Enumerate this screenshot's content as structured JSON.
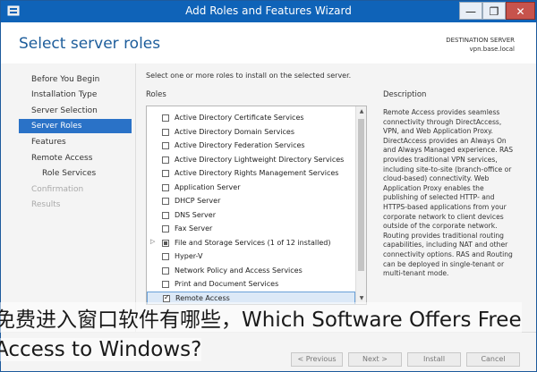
{
  "window": {
    "title": "Add Roles and Features Wizard",
    "controls": {
      "minimize": "—",
      "maximize": "❐",
      "close": "✕"
    }
  },
  "header": {
    "page_title": "Select server roles",
    "destination_label": "DESTINATION SERVER",
    "destination_value": "vpn.base.local"
  },
  "sidebar": {
    "items": [
      {
        "label": "Before You Begin",
        "state": "normal"
      },
      {
        "label": "Installation Type",
        "state": "normal"
      },
      {
        "label": "Server Selection",
        "state": "normal"
      },
      {
        "label": "Server Roles",
        "state": "active"
      },
      {
        "label": "Features",
        "state": "normal"
      },
      {
        "label": "Remote Access",
        "state": "normal"
      },
      {
        "label": "Role Services",
        "state": "sub"
      },
      {
        "label": "Confirmation",
        "state": "disabled"
      },
      {
        "label": "Results",
        "state": "disabled"
      }
    ]
  },
  "main": {
    "instruction": "Select one or more roles to install on the selected server.",
    "roles_heading": "Roles",
    "description_heading": "Description",
    "roles": [
      {
        "label": "Active Directory Certificate Services",
        "state": "unchecked"
      },
      {
        "label": "Active Directory Domain Services",
        "state": "unchecked"
      },
      {
        "label": "Active Directory Federation Services",
        "state": "unchecked"
      },
      {
        "label": "Active Directory Lightweight Directory Services",
        "state": "unchecked"
      },
      {
        "label": "Active Directory Rights Management Services",
        "state": "unchecked"
      },
      {
        "label": "Application Server",
        "state": "unchecked"
      },
      {
        "label": "DHCP Server",
        "state": "unchecked"
      },
      {
        "label": "DNS Server",
        "state": "unchecked"
      },
      {
        "label": "Fax Server",
        "state": "unchecked"
      },
      {
        "label": "File and Storage Services (1 of 12 installed)",
        "state": "partial",
        "expandable": true
      },
      {
        "label": "Hyper-V",
        "state": "unchecked"
      },
      {
        "label": "Network Policy and Access Services",
        "state": "unchecked"
      },
      {
        "label": "Print and Document Services",
        "state": "unchecked"
      },
      {
        "label": "Remote Access",
        "state": "checked",
        "selected": true
      }
    ],
    "description_text": "Remote Access provides seamless connectivity through DirectAccess, VPN, and Web Application Proxy. DirectAccess provides an Always On and Always Managed experience. RAS provides traditional VPN services, including site-to-site (branch-office or cloud-based) connectivity. Web Application Proxy enables the publishing of selected HTTP- and HTTPS-based applications from your corporate network to client devices outside of the corporate network. Routing provides traditional routing capabilities, including NAT and other connectivity options. RAS and Routing can be deployed in single-tenant or multi-tenant mode."
  },
  "footer": {
    "previous_label": "< Previous",
    "next_label": "Next >",
    "install_label": "Install",
    "cancel_label": "Cancel"
  },
  "overlay": {
    "line1": "免费进入窗口软件有哪些，Which Software Offers Free",
    "line2": "Access to Windows?"
  }
}
